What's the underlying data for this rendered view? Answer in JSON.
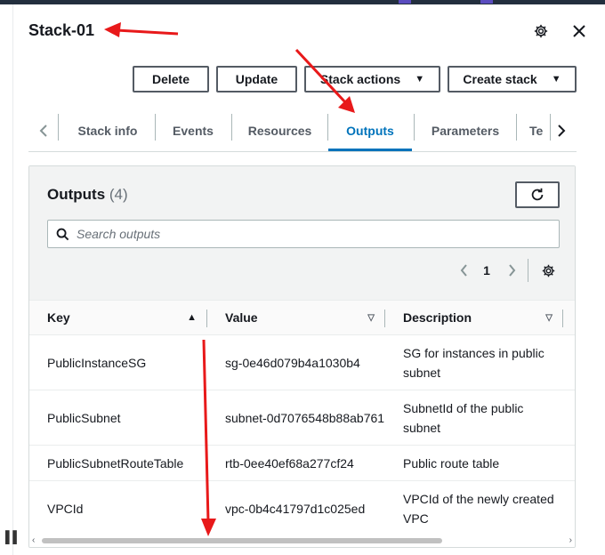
{
  "panel": {
    "title": "Stack-01",
    "icons": {
      "settings": "gear-icon",
      "close": "close-icon"
    }
  },
  "toolbar": {
    "delete_label": "Delete",
    "update_label": "Update",
    "stack_actions_label": "Stack actions",
    "create_stack_label": "Create stack"
  },
  "tabs": {
    "items": [
      "Stack info",
      "Events",
      "Resources",
      "Outputs",
      "Parameters",
      "Te"
    ],
    "active": "Outputs"
  },
  "outputs": {
    "title": "Outputs",
    "count": "(4)",
    "search_placeholder": "Search outputs",
    "page": "1",
    "columns": [
      "Key",
      "Value",
      "Description"
    ],
    "rows": [
      {
        "key": "PublicInstanceSG",
        "value": "sg-0e46d079b4a1030b4",
        "description": "SG for instances in public subnet"
      },
      {
        "key": "PublicSubnet",
        "value": "subnet-0d7076548b88ab761",
        "description": "SubnetId of the public subnet"
      },
      {
        "key": "PublicSubnetRouteTable",
        "value": "rtb-0ee40ef68a277cf24",
        "description": "Public route table"
      },
      {
        "key": "VPCId",
        "value": "vpc-0b4c41797d1c025ed",
        "description": "VPCId of the newly created VPC"
      }
    ]
  },
  "colors": {
    "accent": "#0073bb",
    "annotation_arrow": "#e8191a",
    "header_bg": "#232f3e"
  }
}
